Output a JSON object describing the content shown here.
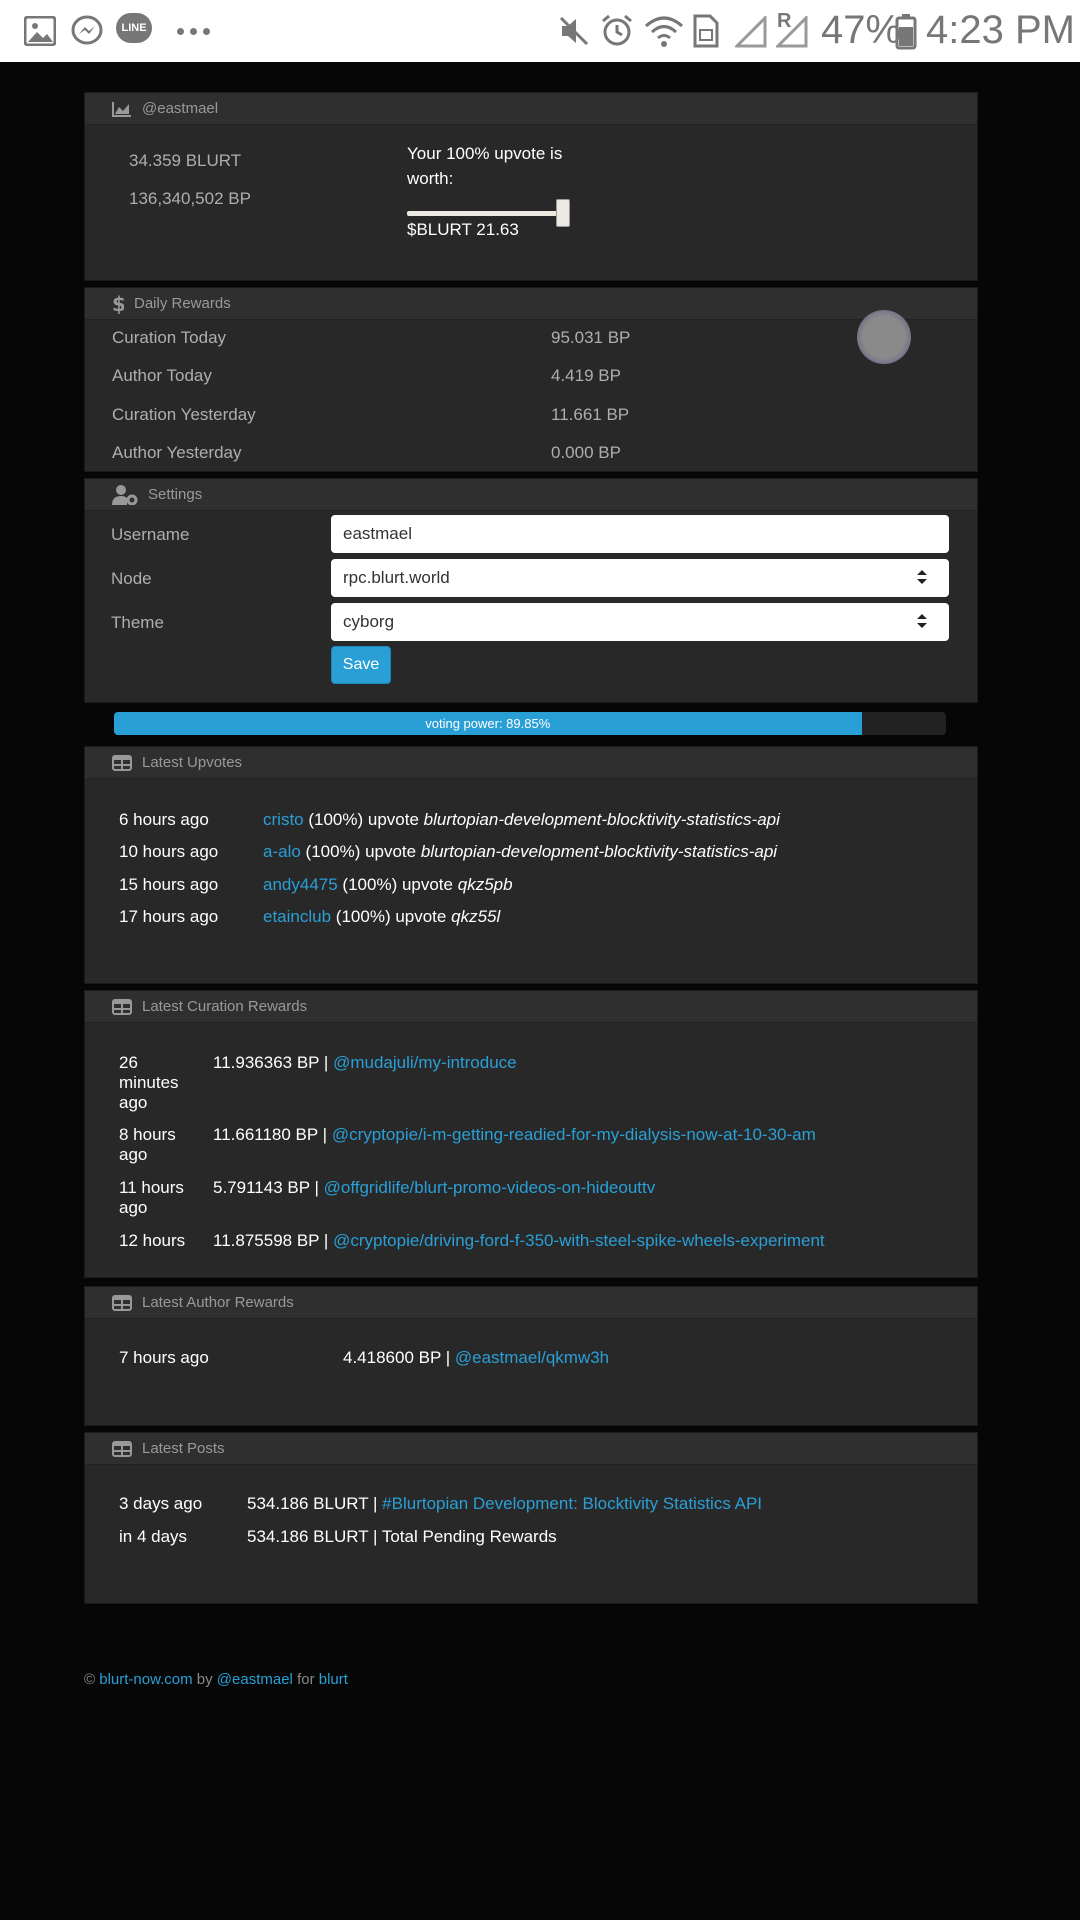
{
  "status_bar": {
    "battery": "47%",
    "time": "4:23 PM",
    "left_icons": [
      "gallery-icon",
      "messenger-icon",
      "line-icon",
      "more-dots-icon"
    ],
    "line_badge": "LINE",
    "roaming_mark": "R",
    "right_icons": [
      "mute-icon",
      "alarm-icon",
      "wifi-icon",
      "sim-icon",
      "signal-icon",
      "roaming-signal-icon",
      "battery-icon"
    ]
  },
  "account": {
    "title": "@eastmael",
    "blurt_balance": "34.359 BLURT",
    "bp_balance": "136,340,502 BP",
    "upvote_text": "Your 100% upvote is worth:",
    "upvote_value": "$BLURT 21.63",
    "slider_percent": 100
  },
  "daily_rewards": {
    "title": "Daily Rewards",
    "rows": [
      {
        "label": "Curation Today",
        "value": "95.031 BP"
      },
      {
        "label": "Author Today",
        "value": "4.419 BP"
      },
      {
        "label": "Curation Yesterday",
        "value": "11.661 BP"
      },
      {
        "label": "Author Yesterday",
        "value": "0.000 BP"
      }
    ]
  },
  "settings": {
    "title": "Settings",
    "username_label": "Username",
    "username_value": "eastmael",
    "node_label": "Node",
    "node_value": "rpc.blurt.world",
    "theme_label": "Theme",
    "theme_value": "cyborg",
    "save_label": "Save"
  },
  "voting_power": {
    "label": "voting power: 89.85%",
    "percent": 89.85
  },
  "latest_upvotes": {
    "title": "Latest Upvotes",
    "rows": [
      {
        "time": "6 hours ago",
        "user": "cristo",
        "pct": "(100%) upvote",
        "post": "blurtopian-development-blocktivity-statistics-api"
      },
      {
        "time": "10 hours ago",
        "user": "a-alo",
        "pct": "(100%) upvote",
        "post": "blurtopian-development-blocktivity-statistics-api"
      },
      {
        "time": "15 hours ago",
        "user": "andy4475",
        "pct": "(100%) upvote",
        "post": "qkz5pb"
      },
      {
        "time": "17 hours ago",
        "user": "etainclub",
        "pct": "(100%) upvote",
        "post": "qkz55l"
      }
    ]
  },
  "latest_curation": {
    "title": "Latest Curation Rewards",
    "rows": [
      {
        "time": "26 minutes ago",
        "amount": "11.936363 BP |",
        "link": "@mudajuli/my-introduce"
      },
      {
        "time": "8 hours ago",
        "amount": "11.661180 BP |",
        "link": "@cryptopie/i-m-getting-readied-for-my-dialysis-now-at-10-30-am"
      },
      {
        "time": "11 hours ago",
        "amount": "5.791143 BP |",
        "link": "@offgridlife/blurt-promo-videos-on-hideouttv"
      },
      {
        "time": "12 hours",
        "amount": "11.875598 BP |",
        "link": "@cryptopie/driving-ford-f-350-with-steel-spike-wheels-experiment"
      }
    ]
  },
  "latest_author": {
    "title": "Latest Author Rewards",
    "rows": [
      {
        "time": "7 hours ago",
        "amount": "4.418600 BP |",
        "link": "@eastmael/qkmw3h"
      }
    ]
  },
  "latest_posts": {
    "title": "Latest Posts",
    "rows": [
      {
        "time": "3 days ago",
        "amount": "534.186 BLURT |",
        "link": "#Blurtopian Development: Blocktivity Statistics API"
      },
      {
        "time": "in 4 days",
        "amount": "534.186 BLURT | Total Pending Rewards"
      }
    ]
  },
  "footer": {
    "copyright": "©",
    "site": "blurt-now.com",
    "by": "by",
    "author": "@eastmael",
    "for": "for",
    "chain": "blurt"
  },
  "colors": {
    "accent": "#2a9fd6",
    "panel": "#282828",
    "background": "#060606"
  }
}
